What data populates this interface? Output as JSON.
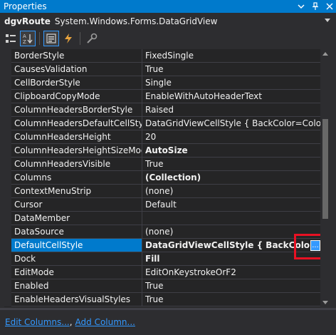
{
  "window": {
    "title": "Properties"
  },
  "object": {
    "name": "dgvRoute",
    "type": "System.Windows.Forms.DataGridView"
  },
  "toolbar": {
    "buttons": [
      "categorized-icon",
      "alphabetical-icon",
      "properties-icon",
      "events-icon",
      "property-pages-icon"
    ]
  },
  "properties": [
    {
      "name": "BorderStyle",
      "value": "FixedSingle",
      "bold": false
    },
    {
      "name": "CausesValidation",
      "value": "True",
      "bold": false
    },
    {
      "name": "CellBorderStyle",
      "value": "Single",
      "bold": false
    },
    {
      "name": "ClipboardCopyMode",
      "value": "EnableWithAutoHeaderText",
      "bold": false
    },
    {
      "name": "ColumnHeadersBorderStyle",
      "value": "Raised",
      "bold": false
    },
    {
      "name": "ColumnHeadersDefaultCellStyle",
      "value": "DataGridViewCellStyle { BackColor=Color [Co",
      "bold": false
    },
    {
      "name": "ColumnHeadersHeight",
      "value": "20",
      "bold": false
    },
    {
      "name": "ColumnHeadersHeightSizeMode",
      "value": "AutoSize",
      "bold": true
    },
    {
      "name": "ColumnHeadersVisible",
      "value": "True",
      "bold": false
    },
    {
      "name": "Columns",
      "value": "(Collection)",
      "bold": true
    },
    {
      "name": "ContextMenuStrip",
      "value": "(none)",
      "bold": false
    },
    {
      "name": "Cursor",
      "value": "Default",
      "bold": false
    },
    {
      "name": "DataMember",
      "value": "",
      "bold": false
    },
    {
      "name": "DataSource",
      "value": "(none)",
      "bold": false
    },
    {
      "name": "DefaultCellStyle",
      "value": "DataGridViewCellStyle { BackColor=Col",
      "bold": true,
      "selected": true,
      "button": "..."
    },
    {
      "name": "Dock",
      "value": "Fill",
      "bold": true
    },
    {
      "name": "EditMode",
      "value": "EditOnKeystrokeOrF2",
      "bold": false
    },
    {
      "name": "Enabled",
      "value": "True",
      "bold": false
    },
    {
      "name": "EnableHeadersVisualStyles",
      "value": "True",
      "bold": false
    }
  ],
  "commands": {
    "edit_columns": "Edit Columns...",
    "separator": ",",
    "add_column": "Add Column..."
  },
  "colors": {
    "accent": "#007acc",
    "background": "#2d2d30",
    "grid": "#252526",
    "highlight": "#e81123",
    "link": "#3399ff"
  }
}
